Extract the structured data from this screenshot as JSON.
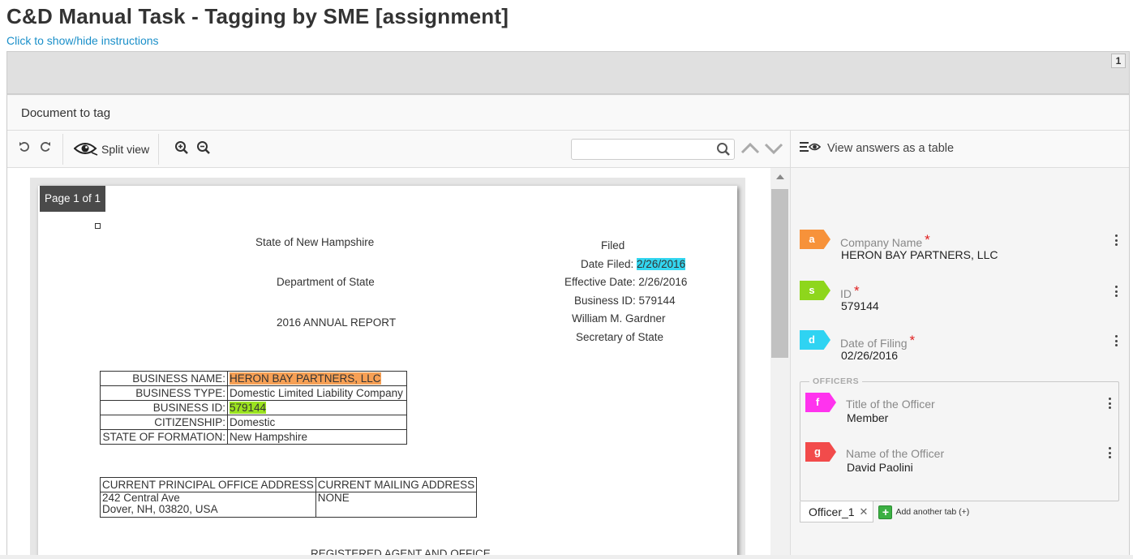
{
  "header": {
    "title": "C&D Manual Task - Tagging by SME [assignment]",
    "instructions_link": "Click to show/hide instructions",
    "page_number": "1"
  },
  "document_section": {
    "title": "Document to tag"
  },
  "toolbar": {
    "split_view_label": "Split view",
    "search_placeholder": "",
    "icons": [
      "undo-icon",
      "redo-icon",
      "eye-icon",
      "zoom-in-icon",
      "zoom-out-icon",
      "search-icon",
      "chevron-up-icon",
      "chevron-down-icon"
    ]
  },
  "document": {
    "page_label": "Page 1 of 1",
    "left_header": [
      "State of New Hampshire",
      "Department of State",
      "2016 ANNUAL REPORT"
    ],
    "right_header": {
      "filed": "Filed",
      "date_filed_label": "Date Filed:",
      "date_filed_value": "2/26/2016",
      "effective_date": "Effective Date: 2/26/2016",
      "business_id": "Business ID: 579144",
      "signer": "William M. Gardner",
      "signer_title": "Secretary of State"
    },
    "business_table": [
      {
        "label": "BUSINESS NAME:",
        "value": "HERON BAY PARTNERS, LLC",
        "highlight": "orange"
      },
      {
        "label": "BUSINESS TYPE:",
        "value": "Domestic Limited Liability Company",
        "highlight": ""
      },
      {
        "label": "BUSINESS ID:",
        "value": "579144",
        "highlight": "green"
      },
      {
        "label": "CITIZENSHIP:",
        "value": "Domestic",
        "highlight": ""
      },
      {
        "label": "STATE OF FORMATION:",
        "value": "New Hampshire",
        "highlight": ""
      }
    ],
    "address_table": {
      "headers": [
        "CURRENT PRINCIPAL OFFICE ADDRESS",
        "CURRENT MAILING ADDRESS"
      ],
      "principal_line1": "242 Central Ave",
      "principal_line2": "Dover, NH, 03820, USA",
      "mailing": "NONE"
    },
    "footer_text": "REGISTERED AGENT AND OFFICE"
  },
  "right_panel": {
    "view_answers_label": "View answers as a table",
    "fields": [
      {
        "key": "a",
        "label": "Company Name",
        "required": true,
        "value": "HERON BAY PARTNERS, LLC",
        "color": "#f7923a"
      },
      {
        "key": "s",
        "label": "ID",
        "required": true,
        "value": "579144",
        "color": "#8ed61c"
      },
      {
        "key": "d",
        "label": "Date of Filing",
        "required": true,
        "value": "02/26/2016",
        "color": "#2fd3f2"
      }
    ],
    "officers": {
      "legend": "OFFICERS",
      "fields": [
        {
          "key": "f",
          "label": "Title of the Officer",
          "value": "Member",
          "color": "#ff33ee"
        },
        {
          "key": "g",
          "label": "Name of the Officer",
          "value": "David Paolini",
          "color": "#f24b4b"
        }
      ],
      "tab_label": "Officer_1",
      "add_tab_label": "Add another tab (+)"
    }
  },
  "colors": {
    "accent_link": "#1a8fc9",
    "highlight_orange": "#f7a055",
    "highlight_green": "#9be31f",
    "highlight_cyan": "#33d6f0"
  }
}
